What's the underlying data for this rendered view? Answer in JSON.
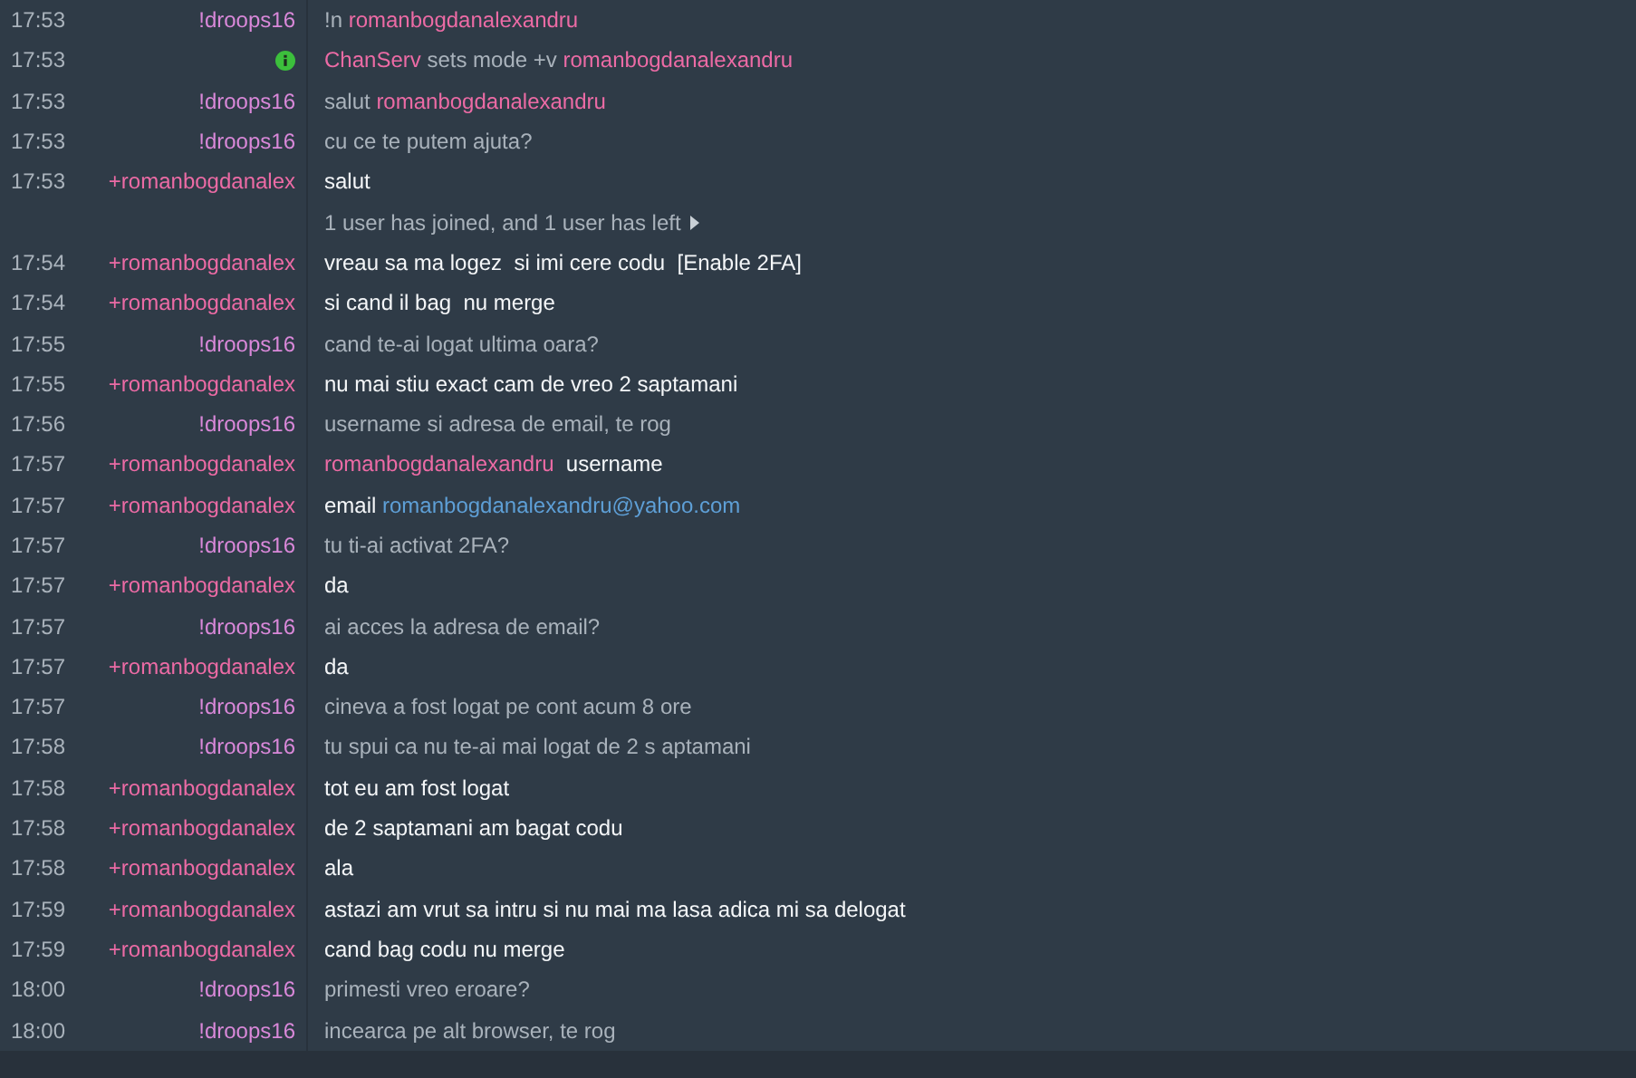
{
  "messages": [
    {
      "kind": "message",
      "time": "17:53",
      "nick": "!droops16",
      "color": "#d988d9",
      "emphasized": false,
      "parts": [
        {
          "kind": "text",
          "text": "!n "
        },
        {
          "kind": "mention",
          "text": "romanbogdanalexandru"
        }
      ]
    },
    {
      "kind": "status",
      "time": "17:53",
      "parts": [
        {
          "kind": "mention",
          "text": "ChanServ"
        },
        {
          "kind": "text",
          "text": " sets mode +v "
        },
        {
          "kind": "mention",
          "text": "romanbogdanalexandru"
        }
      ]
    },
    {
      "kind": "message",
      "time": "17:53",
      "nick": "!droops16",
      "color": "#d988d9",
      "emphasized": false,
      "parts": [
        {
          "kind": "text",
          "text": "salut "
        },
        {
          "kind": "mention",
          "text": "romanbogdanalexandru"
        }
      ]
    },
    {
      "kind": "message",
      "time": "17:53",
      "nick": "!droops16",
      "color": "#d988d9",
      "emphasized": false,
      "parts": [
        {
          "kind": "text",
          "text": "cu ce te putem ajuta?"
        }
      ]
    },
    {
      "kind": "message",
      "time": "17:53",
      "nick": "+romanbogdanalex",
      "color": "#ec6ba5",
      "emphasized": true,
      "parts": [
        {
          "kind": "text",
          "text": "salut"
        }
      ]
    },
    {
      "kind": "event",
      "parts": [
        {
          "kind": "text",
          "text": "1 user has joined, and 1 user has left"
        }
      ]
    },
    {
      "kind": "message",
      "time": "17:54",
      "nick": "+romanbogdanalex",
      "color": "#ec6ba5",
      "emphasized": true,
      "parts": [
        {
          "kind": "text",
          "text": "vreau sa ma logez  si imi cere codu  [Enable 2FA]"
        }
      ]
    },
    {
      "kind": "message",
      "time": "17:54",
      "nick": "+romanbogdanalex",
      "color": "#ec6ba5",
      "emphasized": true,
      "parts": [
        {
          "kind": "text",
          "text": "si cand il bag  nu merge"
        }
      ]
    },
    {
      "kind": "message",
      "time": "17:55",
      "nick": "!droops16",
      "color": "#d988d9",
      "emphasized": false,
      "parts": [
        {
          "kind": "text",
          "text": "cand te-ai logat ultima oara?"
        }
      ]
    },
    {
      "kind": "message",
      "time": "17:55",
      "nick": "+romanbogdanalex",
      "color": "#ec6ba5",
      "emphasized": true,
      "parts": [
        {
          "kind": "text",
          "text": "nu mai stiu exact cam de vreo 2 saptamani"
        }
      ]
    },
    {
      "kind": "message",
      "time": "17:56",
      "nick": "!droops16",
      "color": "#d988d9",
      "emphasized": false,
      "parts": [
        {
          "kind": "text",
          "text": "username si adresa de email, te rog"
        }
      ]
    },
    {
      "kind": "message",
      "time": "17:57",
      "nick": "+romanbogdanalex",
      "color": "#ec6ba5",
      "emphasized": true,
      "parts": [
        {
          "kind": "mention",
          "text": "romanbogdanalexandru"
        },
        {
          "kind": "text",
          "text": "  username"
        }
      ]
    },
    {
      "kind": "message",
      "time": "17:57",
      "nick": "+romanbogdanalex",
      "color": "#ec6ba5",
      "emphasized": true,
      "parts": [
        {
          "kind": "text",
          "text": "email "
        },
        {
          "kind": "link",
          "text": "romanbogdanalexandru@yahoo.com"
        }
      ]
    },
    {
      "kind": "message",
      "time": "17:57",
      "nick": "!droops16",
      "color": "#d988d9",
      "emphasized": false,
      "parts": [
        {
          "kind": "text",
          "text": "tu ti-ai activat 2FA?"
        }
      ]
    },
    {
      "kind": "message",
      "time": "17:57",
      "nick": "+romanbogdanalex",
      "color": "#ec6ba5",
      "emphasized": true,
      "parts": [
        {
          "kind": "text",
          "text": "da"
        }
      ]
    },
    {
      "kind": "message",
      "time": "17:57",
      "nick": "!droops16",
      "color": "#d988d9",
      "emphasized": false,
      "parts": [
        {
          "kind": "text",
          "text": "ai acces la adresa de email?"
        }
      ]
    },
    {
      "kind": "message",
      "time": "17:57",
      "nick": "+romanbogdanalex",
      "color": "#ec6ba5",
      "emphasized": true,
      "parts": [
        {
          "kind": "text",
          "text": "da"
        }
      ]
    },
    {
      "kind": "message",
      "time": "17:57",
      "nick": "!droops16",
      "color": "#d988d9",
      "emphasized": false,
      "parts": [
        {
          "kind": "text",
          "text": "cineva a fost logat pe cont acum 8 ore"
        }
      ]
    },
    {
      "kind": "message",
      "time": "17:58",
      "nick": "!droops16",
      "color": "#d988d9",
      "emphasized": false,
      "parts": [
        {
          "kind": "text",
          "text": "tu spui ca nu te-ai mai logat de 2 s aptamani"
        }
      ]
    },
    {
      "kind": "message",
      "time": "17:58",
      "nick": "+romanbogdanalex",
      "color": "#ec6ba5",
      "emphasized": true,
      "parts": [
        {
          "kind": "text",
          "text": "tot eu am fost logat"
        }
      ]
    },
    {
      "kind": "message",
      "time": "17:58",
      "nick": "+romanbogdanalex",
      "color": "#ec6ba5",
      "emphasized": true,
      "parts": [
        {
          "kind": "text",
          "text": "de 2 saptamani am bagat codu"
        }
      ]
    },
    {
      "kind": "message",
      "time": "17:58",
      "nick": "+romanbogdanalex",
      "color": "#ec6ba5",
      "emphasized": true,
      "parts": [
        {
          "kind": "text",
          "text": "ala"
        }
      ]
    },
    {
      "kind": "message",
      "time": "17:59",
      "nick": "+romanbogdanalex",
      "color": "#ec6ba5",
      "emphasized": true,
      "parts": [
        {
          "kind": "text",
          "text": "astazi am vrut sa intru si nu mai ma lasa adica mi sa delogat"
        }
      ]
    },
    {
      "kind": "message",
      "time": "17:59",
      "nick": "+romanbogdanalex",
      "color": "#ec6ba5",
      "emphasized": true,
      "parts": [
        {
          "kind": "text",
          "text": "cand bag codu nu merge"
        }
      ]
    },
    {
      "kind": "message",
      "time": "18:00",
      "nick": "!droops16",
      "color": "#d988d9",
      "emphasized": false,
      "parts": [
        {
          "kind": "text",
          "text": "primesti vreo eroare?"
        }
      ]
    },
    {
      "kind": "message",
      "time": "18:00",
      "nick": "!droops16",
      "color": "#d988d9",
      "emphasized": false,
      "parts": [
        {
          "kind": "text",
          "text": "incearca pe alt browser, te rog"
        }
      ]
    }
  ]
}
